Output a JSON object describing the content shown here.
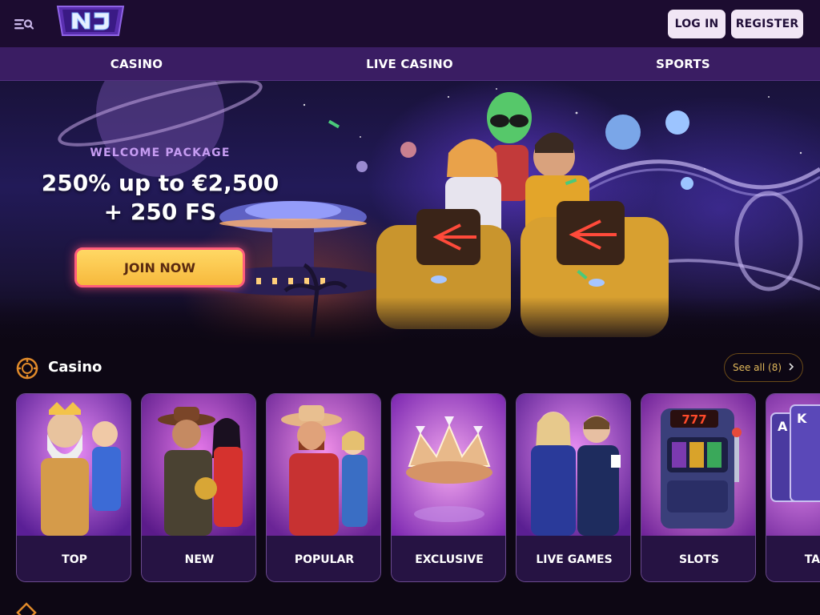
{
  "header": {
    "logo_text": "NJ",
    "login_label": "LOG IN",
    "register_label": "REGISTER"
  },
  "nav": {
    "tabs": [
      {
        "label": "CASINO"
      },
      {
        "label": "LIVE CASINO"
      },
      {
        "label": "SPORTS"
      }
    ]
  },
  "hero": {
    "eyebrow": "WELCOME PACKAGE",
    "title_line1": "250% up to €2,500",
    "title_line2": "+ 250 FS",
    "cta_label": "JOIN NOW"
  },
  "casino_section": {
    "title": "Casino",
    "see_all_label": "See all (8)",
    "cards": [
      {
        "label": "TOP",
        "icon": "god-character-art"
      },
      {
        "label": "NEW",
        "icon": "explorer-character-art"
      },
      {
        "label": "POPULAR",
        "icon": "cowboy-character-art"
      },
      {
        "label": "EXCLUSIVE",
        "icon": "crown-art"
      },
      {
        "label": "LIVE GAMES",
        "icon": "live-dealers-art"
      },
      {
        "label": "SLOTS",
        "icon": "slot-machine-art"
      },
      {
        "label": "TABLE",
        "icon": "playing-cards-art"
      }
    ]
  },
  "colors": {
    "header_bg": "#1c0c30",
    "nav_bg": "#3a1d63",
    "accent_gold": "#e0b85a",
    "cta_yellow": "#ffd864",
    "eyebrow_purple": "#c69cf2"
  }
}
